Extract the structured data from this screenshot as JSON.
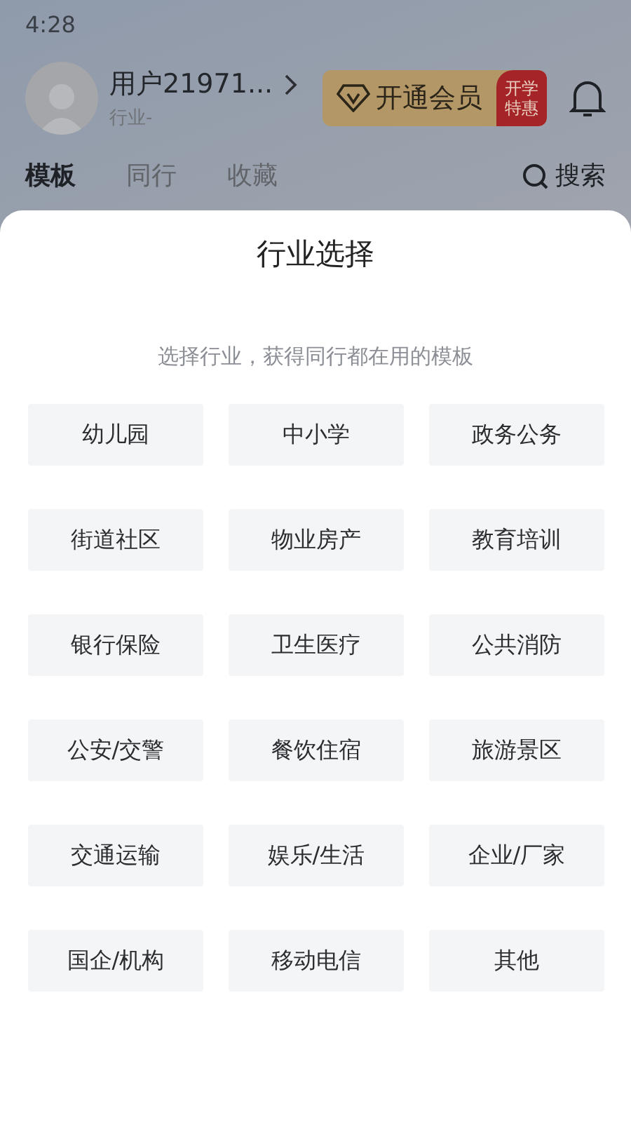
{
  "status_bar": {
    "time": "4:28"
  },
  "profile": {
    "name": "用户21971...",
    "industry": "行业-"
  },
  "vip_button": {
    "label": "开通会员",
    "promo": "开学特惠"
  },
  "tabs": [
    {
      "label": "模板",
      "selected": true
    },
    {
      "label": "同行",
      "selected": false
    },
    {
      "label": "收藏",
      "selected": false
    }
  ],
  "search": {
    "label": "搜索"
  },
  "sheet": {
    "title": "行业选择",
    "subtitle": "选择行业，获得同行都在用的模板",
    "industries": [
      "幼儿园",
      "中小学",
      "政务公务",
      "街道社区",
      "物业房产",
      "教育培训",
      "银行保险",
      "卫生医疗",
      "公共消防",
      "公安/交警",
      "餐饮住宿",
      "旅游景区",
      "交通运输",
      "娱乐/生活",
      "企业/厂家",
      "国企/机构",
      "移动电信",
      "其他"
    ]
  }
}
